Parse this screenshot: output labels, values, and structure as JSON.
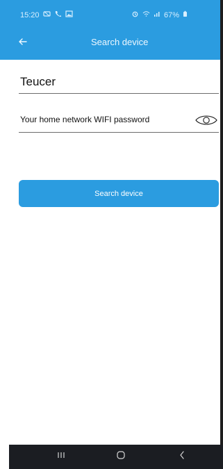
{
  "status_bar": {
    "time": "15:20",
    "battery": "67%",
    "left_icons": [
      "sim-status-icon",
      "call-icon",
      "image-notification-icon"
    ],
    "right_icons": [
      "alarm-icon",
      "wifi-icon",
      "signal-icon",
      "battery-icon"
    ]
  },
  "app_bar": {
    "title": "Search device",
    "back_icon": "back-arrow-icon",
    "background": "#2b9ce0"
  },
  "form": {
    "device_name_value": "Teucer",
    "wifi_password_placeholder": "Your home network WIFI password",
    "visibility_icon": "eye-icon"
  },
  "actions": {
    "search_button_label": "Search device",
    "accent": "#2b9ce0"
  },
  "navigation": {
    "recent_icon": "recent-apps-icon",
    "home_icon": "home-icon",
    "back_icon": "back-icon"
  }
}
